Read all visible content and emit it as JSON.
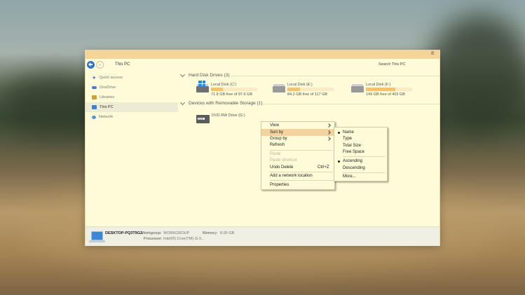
{
  "navigation": {
    "address": "This PC",
    "search_placeholder": "Search This PC",
    "title_controls": "8"
  },
  "sidebar": {
    "items": [
      {
        "label": "Quick access",
        "icon": "star-icon"
      },
      {
        "label": "OneDrive",
        "icon": "cloud-icon"
      },
      {
        "label": "Libraries",
        "icon": "library-icon"
      },
      {
        "label": "This PC",
        "icon": "computer-icon",
        "selected": true
      },
      {
        "label": "Network",
        "icon": "network-icon"
      }
    ]
  },
  "content": {
    "hard_disk_header": "Hard Disk Drives (3)",
    "removable_header": "Devices with Removable Storage (1)",
    "drives": [
      {
        "name": "Local Disk (C:)",
        "free": "71.8 GB free of 97.6 GB",
        "used_fraction": 0.26
      },
      {
        "name": "Local Disk (E:)",
        "free": "84.2 GB free of 117 GB",
        "used_fraction": 0.28
      },
      {
        "name": "Local Disk (F:)",
        "free": "149 GB free of 403 GB",
        "used_fraction": 0.63
      }
    ],
    "dvd": {
      "name": "DVD RW Drive (G:)",
      "label": "DVD"
    }
  },
  "context_menu": {
    "items": [
      {
        "label": "View"
      },
      {
        "label": "Sort by"
      },
      {
        "label": "Group by"
      },
      {
        "label": "Refresh"
      },
      {
        "label": "Paste"
      },
      {
        "label": "Paste shortcut"
      },
      {
        "label": "Undo Delete",
        "shortcut": "Ctrl+Z"
      },
      {
        "label": "Add a network location"
      },
      {
        "label": "Properties"
      }
    ]
  },
  "sort_menu": {
    "items": [
      {
        "label": "Name",
        "checked": true
      },
      {
        "label": "Type"
      },
      {
        "label": "Total Size"
      },
      {
        "label": "Free Space"
      },
      {
        "label": "Ascending",
        "checked": true
      },
      {
        "label": "Descending"
      },
      {
        "label": "More..."
      }
    ]
  },
  "details": {
    "computer_name": "DESKTOP-PQ3T9G2",
    "workgroup_label": "Workgroup:",
    "workgroup_value": "WORKGROUP",
    "memory_label": "Memory:",
    "memory_value": "8.00 GB",
    "processor_label": "Processor:",
    "processor_value": "Intel(R) Core(TM) i3-3..."
  },
  "colors": {
    "window_bg": "#fefbd8",
    "title_bar": "#f5d49a",
    "highlight": "#f4d49e",
    "drive_fill": "#f6c36b",
    "accent_blue": "#2f74c8"
  }
}
